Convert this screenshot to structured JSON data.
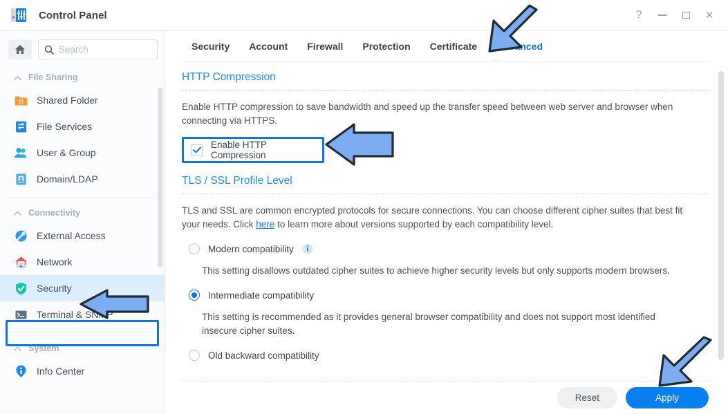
{
  "window": {
    "title": "Control Panel",
    "app_icon": "control-panel-icon",
    "controls": {
      "help": "?",
      "minimize": "minimize",
      "maximize": "maximize",
      "close": "close"
    }
  },
  "sidebar": {
    "home_button": "home-icon",
    "search": {
      "placeholder": "Search",
      "value": "",
      "icon": "search-icon"
    },
    "sections": [
      {
        "label": "File Sharing",
        "items": [
          {
            "label": "Shared Folder",
            "icon": "shared-folder-icon"
          },
          {
            "label": "File Services",
            "icon": "file-services-icon"
          },
          {
            "label": "User & Group",
            "icon": "user-group-icon"
          },
          {
            "label": "Domain/LDAP",
            "icon": "domain-ldap-icon"
          }
        ]
      },
      {
        "label": "Connectivity",
        "items": [
          {
            "label": "External Access",
            "icon": "external-access-icon"
          },
          {
            "label": "Network",
            "icon": "network-icon"
          },
          {
            "label": "Security",
            "icon": "security-shield-icon",
            "selected": true
          },
          {
            "label": "Terminal & SNMP",
            "icon": "terminal-snmp-icon"
          }
        ]
      },
      {
        "label": "System",
        "items": [
          {
            "label": "Info Center",
            "icon": "info-center-icon"
          }
        ]
      }
    ]
  },
  "tabs": [
    {
      "label": "Security",
      "active": false
    },
    {
      "label": "Account",
      "active": false
    },
    {
      "label": "Firewall",
      "active": false
    },
    {
      "label": "Protection",
      "active": false
    },
    {
      "label": "Certificate",
      "active": false
    },
    {
      "label": "Advanced",
      "active": true
    }
  ],
  "main": {
    "http_compression": {
      "title": "HTTP Compression",
      "description": "Enable HTTP compression to save bandwidth and speed up the transfer speed between web server and browser when connecting via HTTPS.",
      "checkbox": {
        "label": "Enable HTTP Compression",
        "checked": true
      }
    },
    "tls_ssl": {
      "title": "TLS / SSL Profile Level",
      "description_before_link": "TLS and SSL are common encrypted protocols for secure connections. You can choose different cipher suites that best fit your needs. Click ",
      "link_text": "here",
      "description_after_link": " to learn more about versions supported by each compatibility level.",
      "options": [
        {
          "label": "Modern compatibility",
          "selected": false,
          "has_info_icon": true,
          "description": "This setting disallows outdated cipher suites to achieve higher security levels but only supports modern browsers."
        },
        {
          "label": "Intermediate compatibility",
          "selected": true,
          "has_info_icon": false,
          "description": "This setting is recommended as it provides general browser compatibility and does not support most identified insecure cipher suites."
        },
        {
          "label": "Old backward compatibility",
          "selected": false,
          "has_info_icon": false,
          "description": ""
        }
      ]
    }
  },
  "footer": {
    "reset_label": "Reset",
    "apply_label": "Apply"
  },
  "annotations": {
    "arrow_fill": "#7badf0",
    "arrow_stroke": "#1f2a37",
    "highlight_color": "#1273e6",
    "targets": [
      "advanced-tab",
      "enable-http-compression-checkbox",
      "sidebar-item-security",
      "apply-button"
    ]
  },
  "colors": {
    "accent": "#1273e6",
    "section_title": "#1c8ef5",
    "apply_button": "#0a7ff0",
    "selected_row": "#ddeeff"
  }
}
